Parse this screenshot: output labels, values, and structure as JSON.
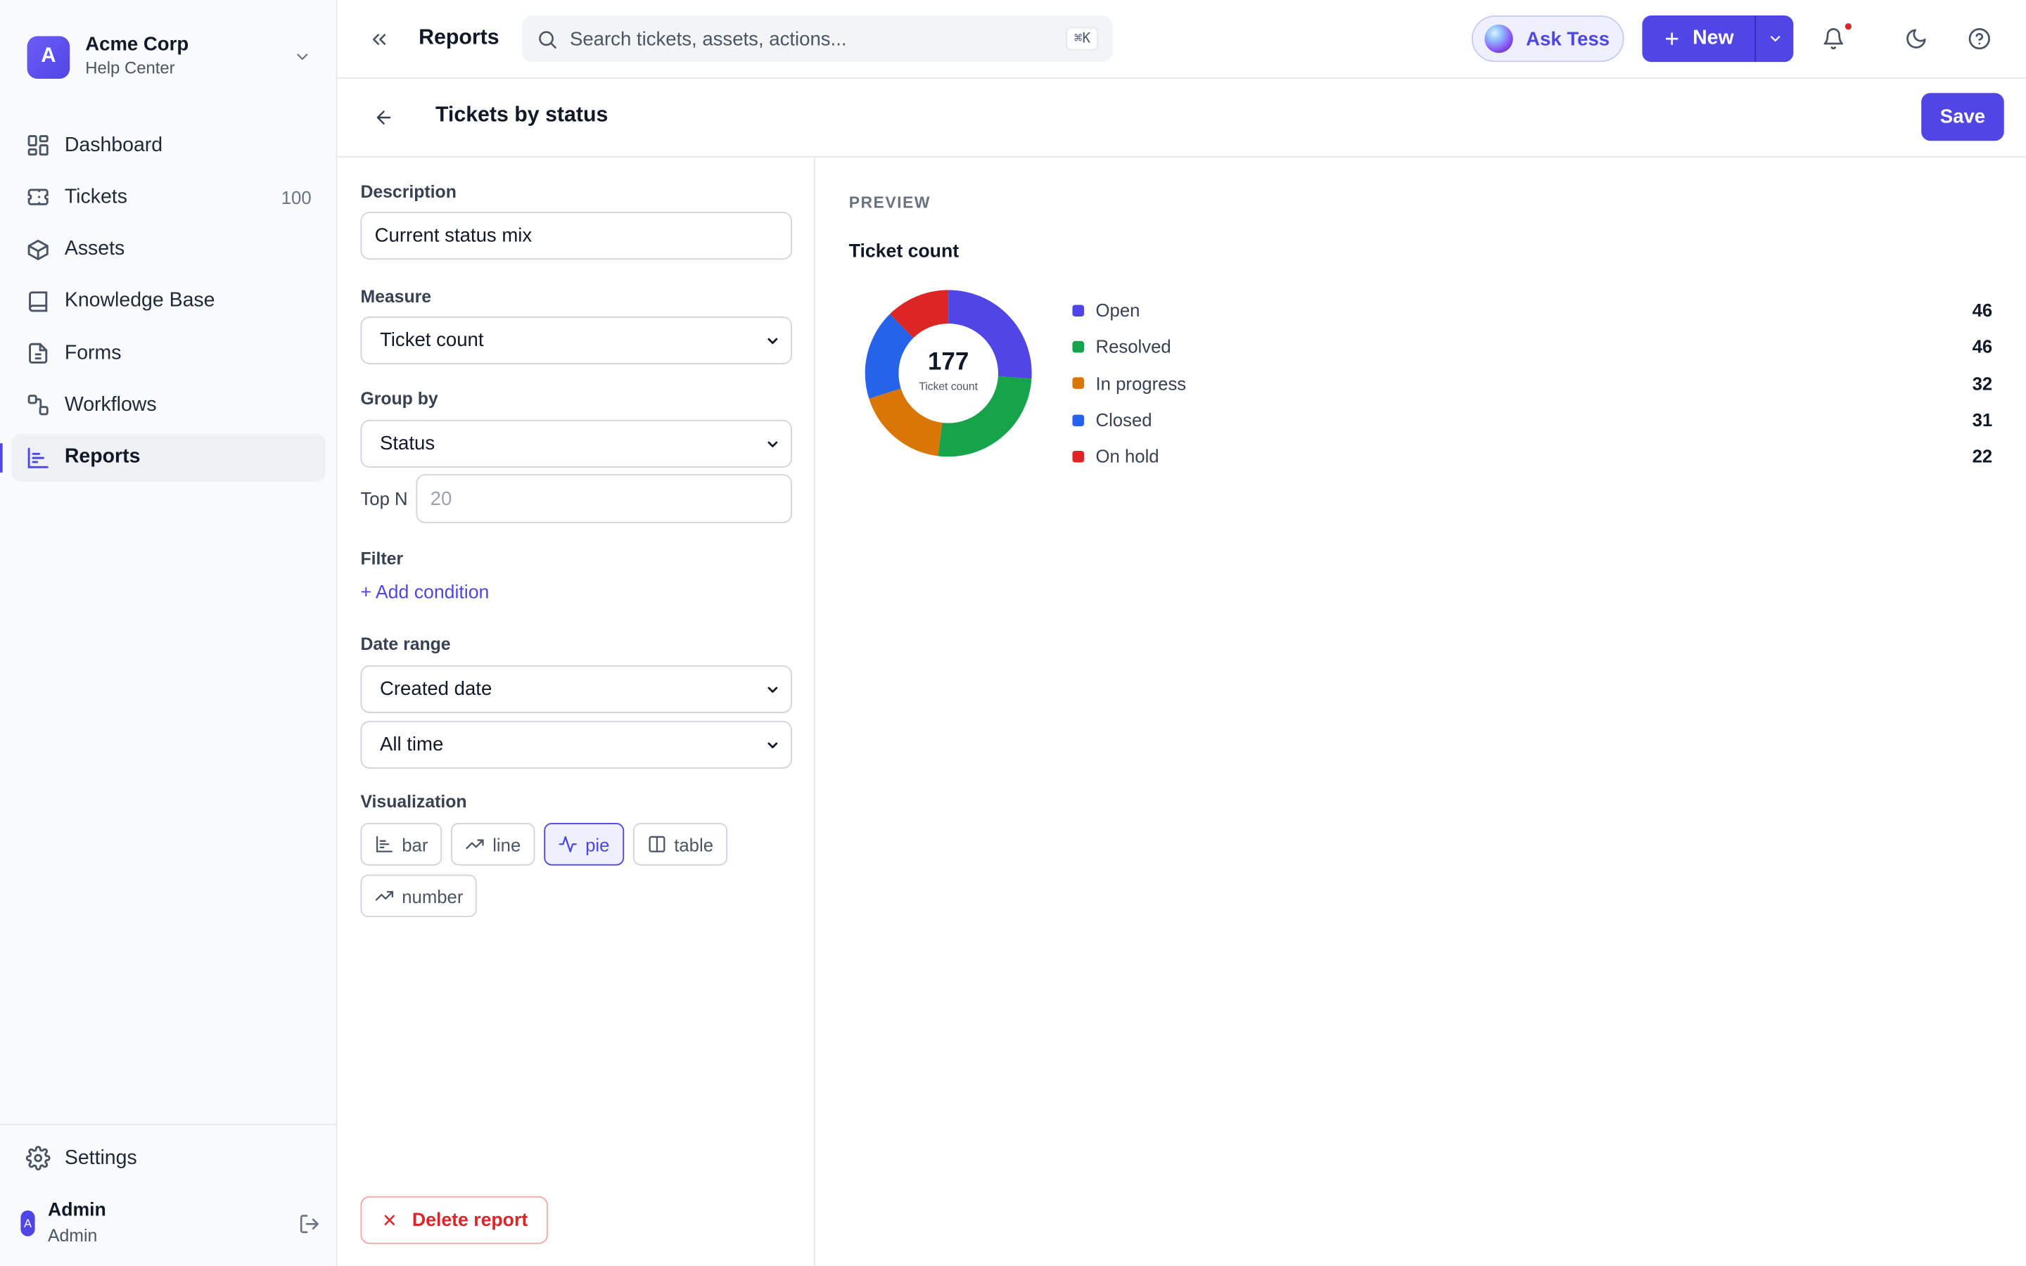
{
  "org": {
    "initial": "A",
    "name": "Acme Corp",
    "subtitle": "Help Center"
  },
  "nav": {
    "items": [
      {
        "label": "Dashboard",
        "icon": "dashboard-icon"
      },
      {
        "label": "Tickets",
        "icon": "ticket-icon",
        "count": "100"
      },
      {
        "label": "Assets",
        "icon": "cube-icon"
      },
      {
        "label": "Knowledge Base",
        "icon": "book-icon"
      },
      {
        "label": "Forms",
        "icon": "file-icon"
      },
      {
        "label": "Workflows",
        "icon": "workflow-icon"
      },
      {
        "label": "Reports",
        "icon": "chart-icon",
        "active": true
      }
    ],
    "settings_label": "Settings"
  },
  "user": {
    "initial": "A",
    "name": "Admin",
    "role": "Admin"
  },
  "topbar": {
    "title": "Reports",
    "search_placeholder": "Search tickets, assets, actions...",
    "search_shortcut": "⌘K",
    "ask_label": "Ask Tess",
    "new_label": "New"
  },
  "report": {
    "title": "Tickets by status",
    "save_label": "Save",
    "description_label": "Description",
    "description_value": "Current status mix",
    "measure_label": "Measure",
    "measure_value": "Ticket count",
    "group_by_label": "Group by",
    "group_by_value": "Status",
    "top_n_label": "Top N",
    "top_n_placeholder": "20",
    "filter_label": "Filter",
    "add_condition_label": "+ Add condition",
    "date_range_label": "Date range",
    "date_field_value": "Created date",
    "date_period_value": "All time",
    "visualization_label": "Visualization",
    "visualizations": [
      {
        "label": "bar",
        "icon": "bar-chart-icon"
      },
      {
        "label": "line",
        "icon": "trend-icon"
      },
      {
        "label": "pie",
        "icon": "pulse-icon",
        "active": true
      },
      {
        "label": "table",
        "icon": "table-icon"
      },
      {
        "label": "number",
        "icon": "trend-icon"
      }
    ],
    "delete_label": "Delete report"
  },
  "preview": {
    "label": "PREVIEW",
    "title": "Ticket count",
    "total": "177",
    "center_label": "Ticket count"
  },
  "chart_data": {
    "type": "pie",
    "title": "Ticket count",
    "categories": [
      "Open",
      "Resolved",
      "In progress",
      "Closed",
      "On hold"
    ],
    "values": [
      46,
      46,
      32,
      31,
      22
    ],
    "colors": [
      "#4f46e5",
      "#16a34a",
      "#d97706",
      "#2563eb",
      "#dc2626"
    ],
    "total": 177,
    "legend": "right"
  }
}
